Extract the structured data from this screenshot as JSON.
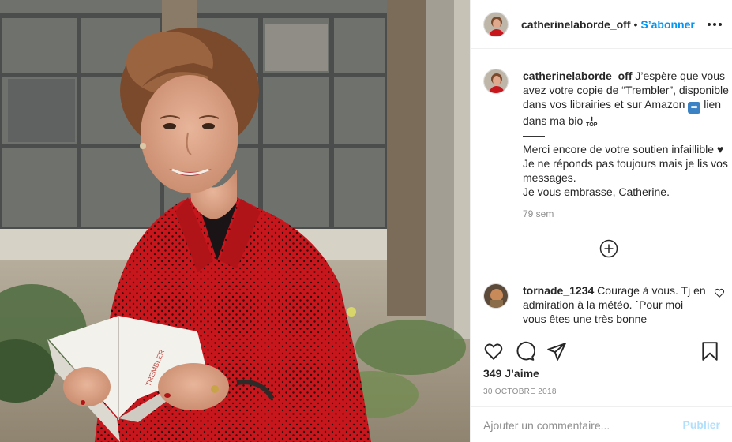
{
  "photo": {
    "alt": "Catherine Laborde holding the book Trembler",
    "book_title": "TREMBLER"
  },
  "post": {
    "author": "catherinelaborde_off",
    "follow_label": "S’abonner",
    "separator": "•"
  },
  "caption": {
    "username": "catherinelaborde_off",
    "line1": "J’espère que vous avez votre copie de “Trembler”, disponible dans vos librairies et sur Amazon",
    "arrow_emoji": "➡",
    "line1_end": "lien dans ma bio",
    "top_emoji": "TOP",
    "dash": "——",
    "line2": "Merci encore de votre soutien infaillible ♥ Je ne réponds pas toujours mais je lis vos messages.",
    "line3": "Je vous embrasse, Catherine.",
    "time": "79 sem"
  },
  "reply": {
    "username": "tornade_1234",
    "text": "Courage à vous. Tj en admiration à la météo. ´Pour moi vous êtes une très bonne"
  },
  "actions": {
    "likes": "349 J’aime",
    "date": "30 OCTOBRE 2018"
  },
  "comment_box": {
    "placeholder": "Ajouter un commentaire...",
    "publish_label": "Publier"
  },
  "colors": {
    "accent": "#0095f6",
    "publish_disabled": "#b2dffc",
    "shirt_red": "#c4161c"
  }
}
